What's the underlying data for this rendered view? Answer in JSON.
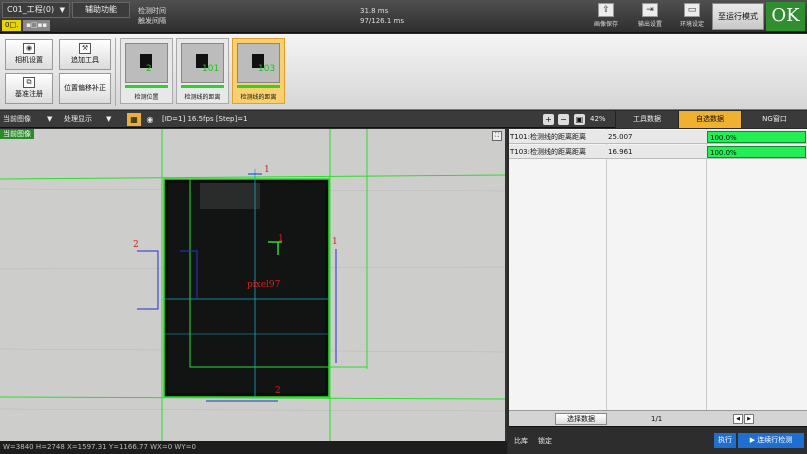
{
  "topbar": {
    "project_label": "C01_工程(0)",
    "aux_label": "辅助功能",
    "chips": [
      "0□.",
      "▪□▪▪"
    ],
    "timing_labels": [
      "检测时间",
      "触发间隔"
    ],
    "timing_values": [
      "31.8 ms",
      "97/126.1 ms"
    ],
    "buttons": [
      "画像保存",
      "输出设置",
      "环境设定"
    ],
    "run_mode_label": "至运行模式",
    "result": "OK"
  },
  "toolpanel": {
    "camera_setup": "相机设置",
    "reference_register": "基准注册",
    "add_tool": "追加工具",
    "position_correction": "位置偏移补正",
    "thumbnails": [
      {
        "caption": "检测位置",
        "index": "2"
      },
      {
        "caption": "检测线的距离",
        "index": "101"
      },
      {
        "caption": "检测线的距离",
        "index": "103"
      }
    ]
  },
  "viewbar": {
    "current_image": "当前图像",
    "processing_display": "处理显示",
    "status": "[ID=1] 16.5fps [Step]=1",
    "zoom": "42%"
  },
  "tabs": [
    "工具数据",
    "自选数据",
    "NG窗口"
  ],
  "image": {
    "current_label": "当前图像",
    "marker_labels": [
      "1",
      "1",
      "1",
      "2",
      "2"
    ],
    "center_text": "pixel97",
    "coord_text": "W=3840 H=2748 X=1597.31 Y=1166.77 WX=0 WY=0"
  },
  "data_rows": [
    {
      "name": "T101:检测线的距离距离",
      "value": "25.007",
      "percent": "100.0%"
    },
    {
      "name": "T103:检测线的距离距离",
      "value": "16.961",
      "percent": "100.0%"
    }
  ],
  "pager": {
    "select_data": "选择数据",
    "page": "1/1",
    "prev": "◀",
    "next": "▶"
  },
  "bottom": {
    "btn1": "比库",
    "btn2": "锁定",
    "run": "执行",
    "continuous_run": "▶ 连续行检测"
  }
}
